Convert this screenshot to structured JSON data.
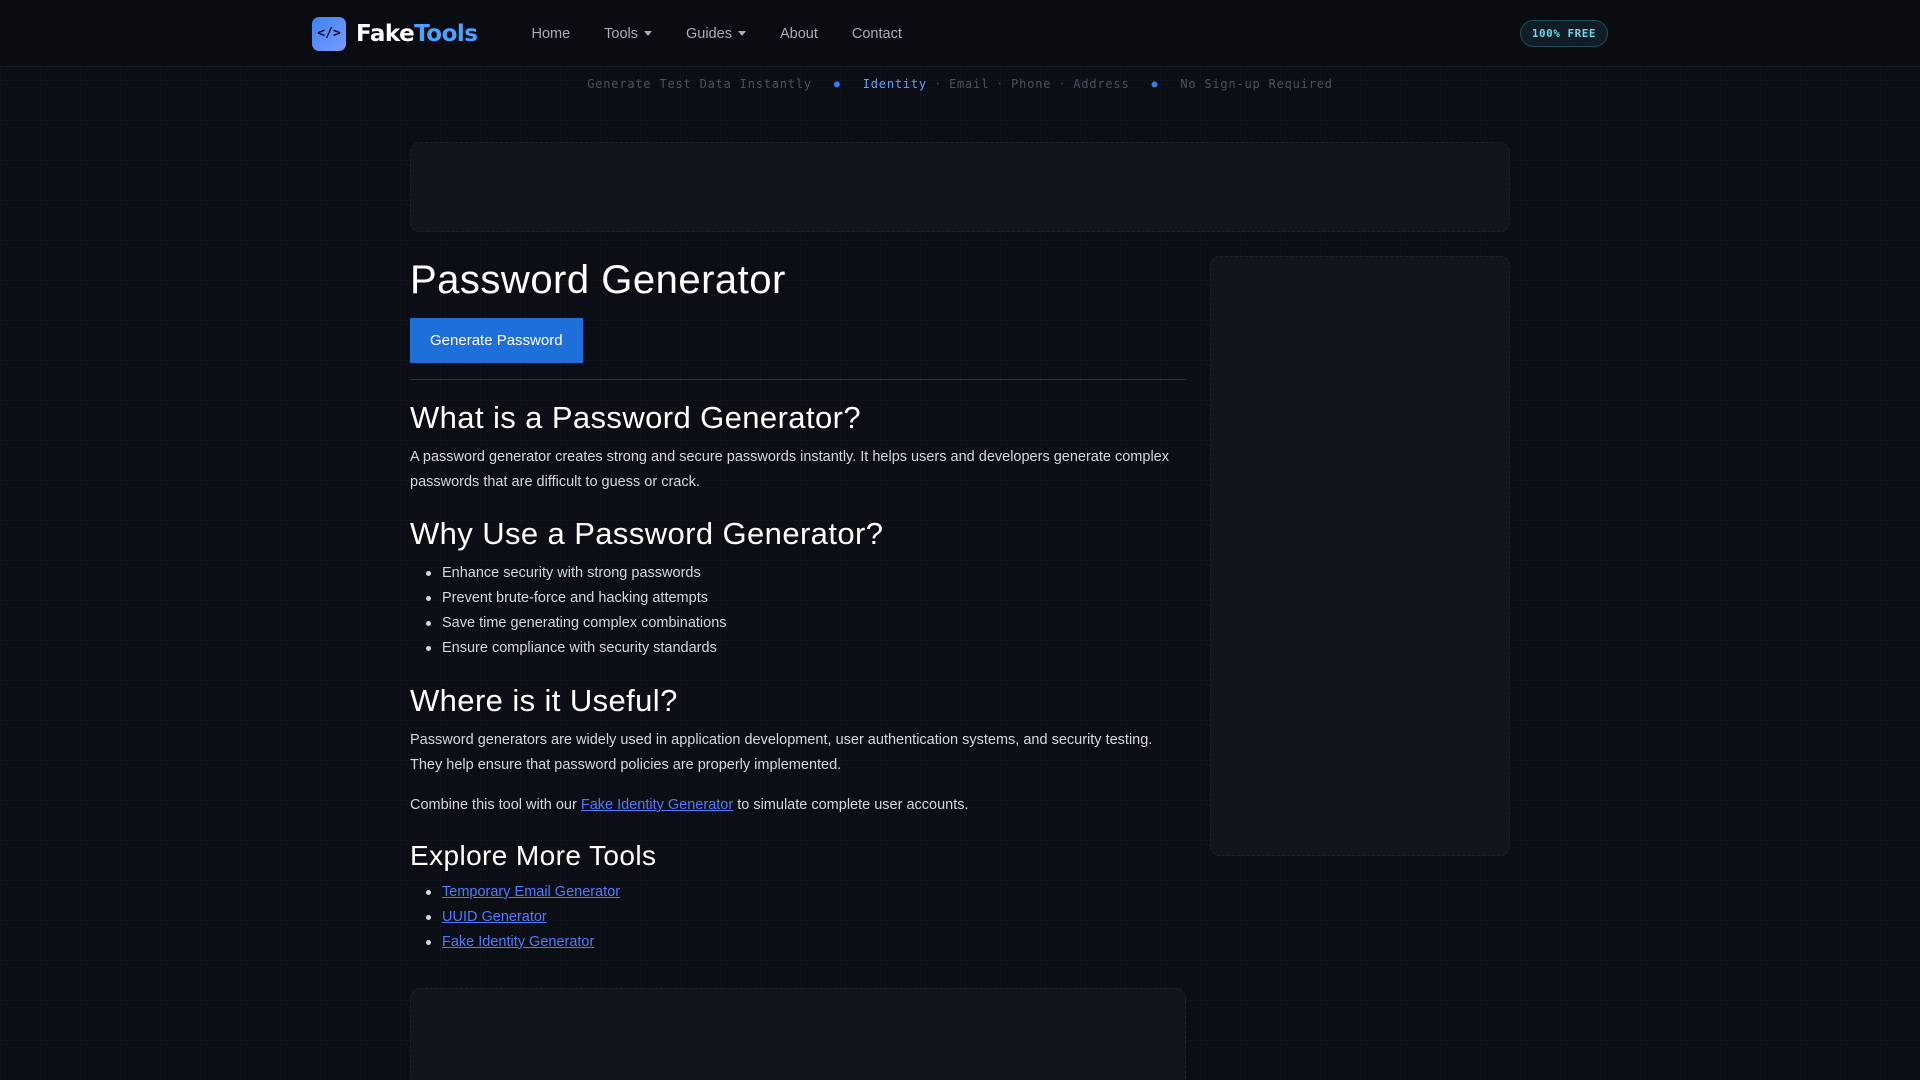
{
  "nav": {
    "logo_symbol": "</>",
    "brand_part1": "Fake",
    "brand_part2": "Tools",
    "links": [
      {
        "label": "Home"
      },
      {
        "label": "Tools"
      },
      {
        "label": "Guides"
      },
      {
        "label": "About"
      },
      {
        "label": "Contact"
      }
    ],
    "badge": "100% FREE"
  },
  "ticker": {
    "left": "Generate Test Data Instantly",
    "highlight": "Identity",
    "items": [
      "Email",
      "Phone",
      "Address"
    ],
    "separator": "·",
    "right": "No Sign-up Required",
    "bullet": "●"
  },
  "main": {
    "title": "Password Generator",
    "generate_button": "Generate Password",
    "section1": {
      "heading": "What is a Password Generator?",
      "text": "A password generator creates strong and secure passwords instantly. It helps users and developers generate complex passwords that are difficult to guess or crack."
    },
    "section2": {
      "heading": "Why Use a Password Generator?",
      "items": [
        "Enhance security with strong passwords",
        "Prevent brute-force and hacking attempts",
        "Save time generating complex combinations",
        "Ensure compliance with security standards"
      ]
    },
    "section3": {
      "heading": "Where is it Useful?",
      "text": "Password generators are widely used in application development, user authentication systems, and security testing. They help ensure that password policies are properly implemented.",
      "combine_prefix": "Combine this tool with our ",
      "combine_link": "Fake Identity Generator",
      "combine_suffix": " to simulate complete user accounts."
    },
    "section4": {
      "heading": "Explore More Tools",
      "links": [
        "Temporary Email Generator",
        "UUID Generator",
        "Fake Identity Generator"
      ]
    }
  },
  "colors": {
    "background": "#0b0e15",
    "accent": "#1e6fd9",
    "brand_accent": "#4aa3ff",
    "link": "#4f7bff"
  }
}
